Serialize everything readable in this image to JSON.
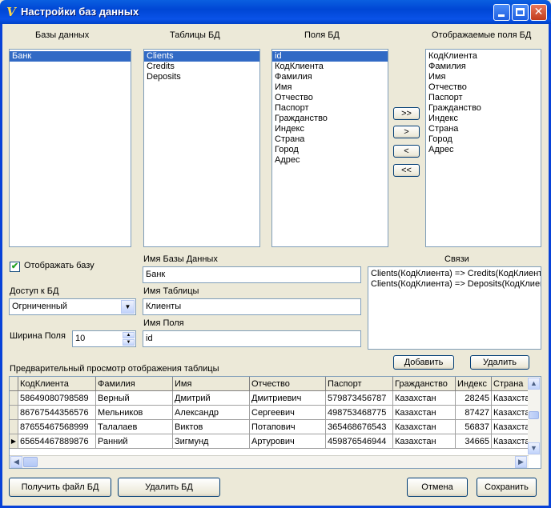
{
  "window": {
    "title": "Настройки баз данных"
  },
  "headings": {
    "databases": "Базы данных",
    "tables": "Таблицы БД",
    "fields": "Поля БД",
    "displayed_fields": "Отображаемые поля БД",
    "relations": "Связи",
    "preview": "Предварительный просмотр отображения таблицы"
  },
  "databases": [
    "Банк"
  ],
  "tables": [
    "Clients",
    "Credits",
    "Deposits"
  ],
  "fields": [
    "id",
    "КодКлиента",
    "Фамилия",
    "Имя",
    "Отчество",
    "Паспорт",
    "Гражданство",
    "Индекс",
    "Страна",
    "Город",
    "Адрес"
  ],
  "displayed_fields": [
    "КодКлиента",
    "Фамилия",
    "Имя",
    "Отчество",
    "Паспорт",
    "Гражданство",
    "Индекс",
    "Страна",
    "Город",
    "Адрес"
  ],
  "move_buttons": {
    "add_all": ">>",
    "add": ">",
    "remove": "<",
    "remove_all": "<<"
  },
  "show_db": {
    "label": "Отображать базу",
    "checked": true
  },
  "access": {
    "label": "Доступ к БД",
    "value": "Огрниченный"
  },
  "width": {
    "label": "Ширина Поля",
    "value": "10"
  },
  "db_name": {
    "label": "Имя Базы Данных",
    "value": "Банк"
  },
  "table_name": {
    "label": "Имя Таблицы",
    "value": "Клиенты"
  },
  "field_name": {
    "label": "Имя Поля",
    "value": "id"
  },
  "relations": [
    "Clients(КодКлиента) => Credits(КодКлиента",
    "Clients(КодКлиента) => Deposits(КодКлиен"
  ],
  "relation_buttons": {
    "add": "Добавить",
    "delete": "Удалить"
  },
  "grid": {
    "columns": [
      "КодКлиента",
      "Фамилия",
      "Имя",
      "Отчество",
      "Паспорт",
      "Гражданство",
      "Индекс",
      "Страна"
    ],
    "rows": [
      [
        "58649080798589",
        "Верный",
        "Дмитрий",
        "Дмитриевич",
        "579873456787",
        "Казахстан",
        "28245",
        "Казахстан"
      ],
      [
        "86767544356576",
        "Мельников",
        "Александр",
        "Сергеевич",
        "498753468775",
        "Казахстан",
        "87427",
        "Казахстан"
      ],
      [
        "87655467568999",
        "Талалаев",
        "Виктов",
        "Потапович",
        "365468676543",
        "Казахстан",
        "56837",
        "Казахстан"
      ],
      [
        "65654467889876",
        "Ранний",
        "Зигмунд",
        "Артурович",
        "459876546944",
        "Казахстан",
        "34665",
        "Казахстан"
      ]
    ],
    "current_row": 3
  },
  "footer_buttons": {
    "get_file": "Получить файл БД",
    "delete_db": "Удалить БД",
    "cancel": "Отмена",
    "save": "Сохранить"
  },
  "colors": {
    "titlebar": "#0046d5",
    "selection": "#316ac5",
    "window_bg": "#ece9d8"
  }
}
